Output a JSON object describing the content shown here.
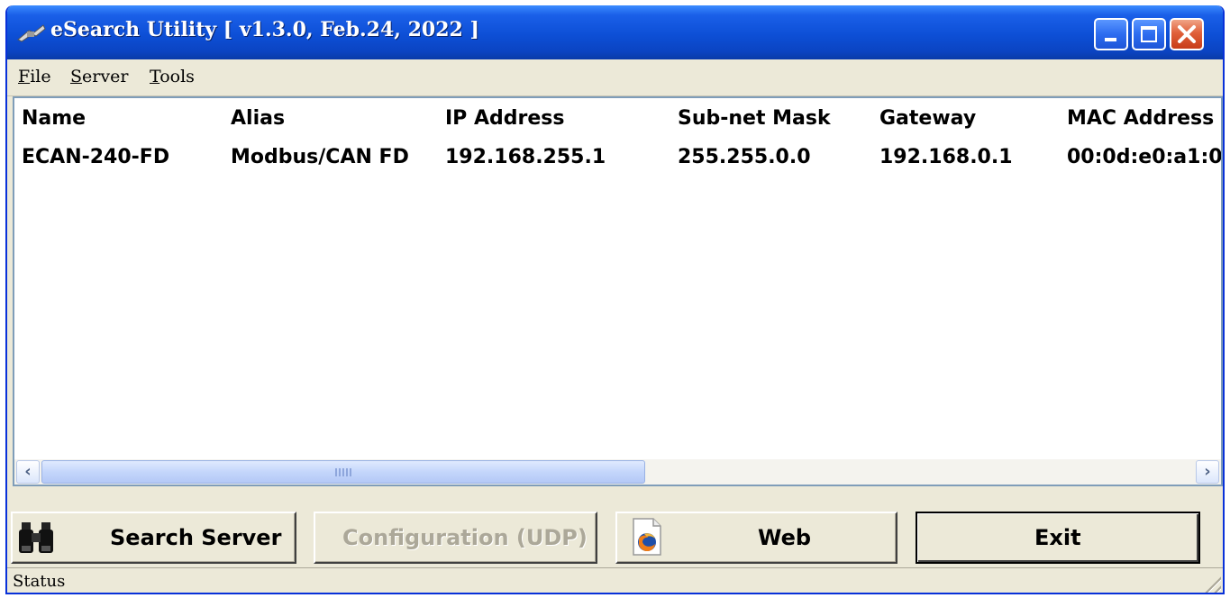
{
  "window": {
    "title": "eSearch Utility [ v1.3.0, Feb.24, 2022 ]",
    "icons": {
      "app": "network-plug-icon",
      "minimize": "minimize-icon",
      "maximize": "maximize-icon",
      "close": "close-icon"
    },
    "colors": {
      "titlebar": "#0d4fd6",
      "close_button": "#e0603a",
      "face": "#ece9d8"
    }
  },
  "menu": {
    "items": [
      "File",
      "Server",
      "Tools"
    ]
  },
  "listview": {
    "columns": [
      "Name",
      "Alias",
      "IP Address",
      "Sub-net Mask",
      "Gateway",
      "MAC Address"
    ],
    "rows": [
      [
        "ECAN-240-FD",
        "Modbus/CAN FD",
        "192.168.255.1",
        "255.255.0.0",
        "192.168.0.1",
        "00:0d:e0:a1:0"
      ]
    ]
  },
  "buttons": {
    "search": {
      "label": "Search Server",
      "icon": "binoculars-icon"
    },
    "config": {
      "label": "Configuration (UDP)",
      "enabled": false
    },
    "web": {
      "label": "Web",
      "icon": "firefox-icon"
    },
    "exit": {
      "label": "Exit"
    }
  },
  "status": {
    "text": "Status"
  }
}
